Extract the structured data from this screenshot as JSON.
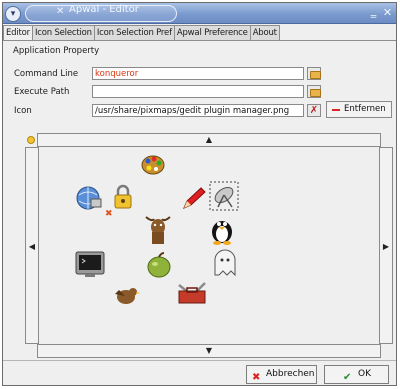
{
  "window": {
    "title": "Apwal - Editor",
    "menu_glyph": "▾",
    "title_x": "✕",
    "minimize_glyph": "‗",
    "close_glyph": "✕"
  },
  "tabs": [
    {
      "label": "Editor",
      "active": true
    },
    {
      "label": "Icon Selection",
      "active": false
    },
    {
      "label": "Icon Selection Pref",
      "active": false
    },
    {
      "label": "Apwal Preference",
      "active": false
    },
    {
      "label": "About",
      "active": false
    }
  ],
  "application_property": {
    "title": "Application Property",
    "command_line": {
      "label": "Command Line",
      "value": "konqueror",
      "value_color": "#d9360f"
    },
    "execute_path": {
      "label": "Execute Path",
      "value": ""
    },
    "icon": {
      "label": "Icon",
      "value": "/usr/share/pixmaps/gedit plugin manager.png"
    },
    "remove_button": "Entfernen"
  },
  "icon_grid": {
    "scroll_up": "▲",
    "scroll_down": "▼",
    "scroll_left": "◀",
    "scroll_right": "▶",
    "icons": [
      {
        "name": "paint-palette-icon"
      },
      {
        "name": "network-globe-icon"
      },
      {
        "name": "padlock-icon"
      },
      {
        "name": "pencil-icon"
      },
      {
        "name": "satellite-dish-icon"
      },
      {
        "name": "gnu-mascot-icon"
      },
      {
        "name": "tux-penguin-icon"
      },
      {
        "name": "terminal-monitor-icon"
      },
      {
        "name": "apple-icon"
      },
      {
        "name": "ghost-icon"
      },
      {
        "name": "bird-icon"
      },
      {
        "name": "toolbox-icon"
      }
    ]
  },
  "buttons": {
    "cancel": {
      "label": "Abbrechen",
      "icon": "cancel-icon"
    },
    "ok": {
      "label": "OK",
      "icon": "checkmark-icon"
    }
  }
}
